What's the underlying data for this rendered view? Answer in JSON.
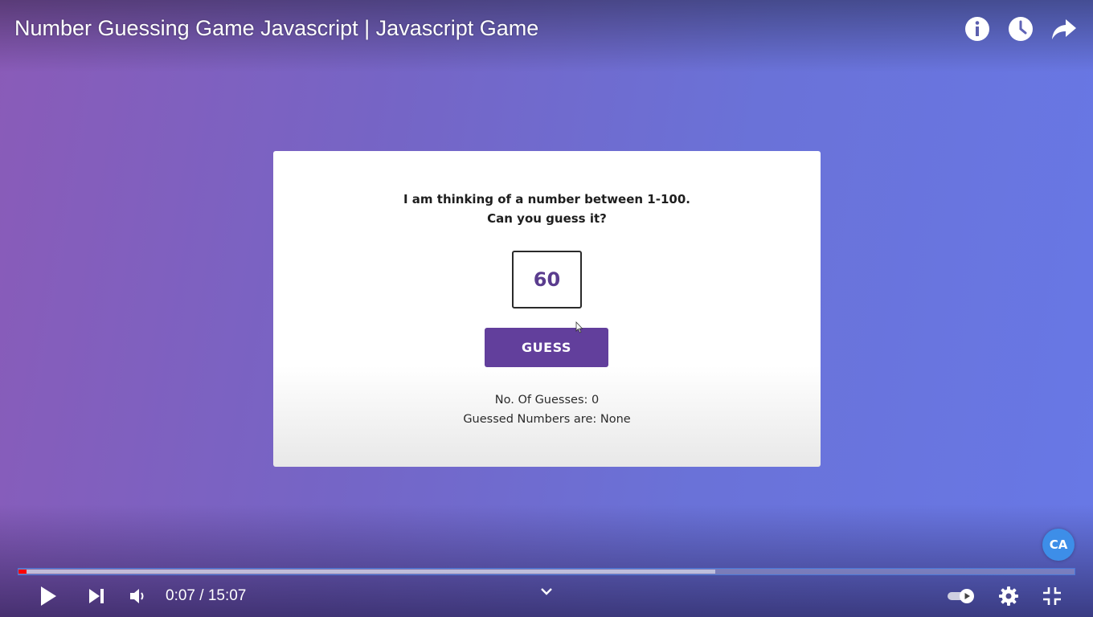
{
  "video": {
    "title": "Number Guessing Game Javascript | Javascript Game",
    "top_icons": [
      "info-icon",
      "watch-later-icon",
      "share-icon"
    ]
  },
  "game": {
    "prompt_line1": "I am thinking of a number between 1-100.",
    "prompt_line2": "Can you guess it?",
    "input_value": "60",
    "button_label": "GUESS",
    "guesses_count_text": "No. Of Guesses: 0",
    "guessed_numbers_text": "Guessed Numbers are: None",
    "button_color": "#623f9c"
  },
  "channel_badge": {
    "text": "CA"
  },
  "player": {
    "time_display": "0:07 / 15:07",
    "progress_fraction": 0.0077,
    "buffered_fraction": 0.66,
    "accent_color": "#ff0000",
    "controls": [
      "play-icon",
      "next-icon",
      "volume-icon",
      "chevron-down-icon",
      "autoplay-toggle",
      "settings-icon",
      "exit-fullscreen-icon"
    ]
  }
}
